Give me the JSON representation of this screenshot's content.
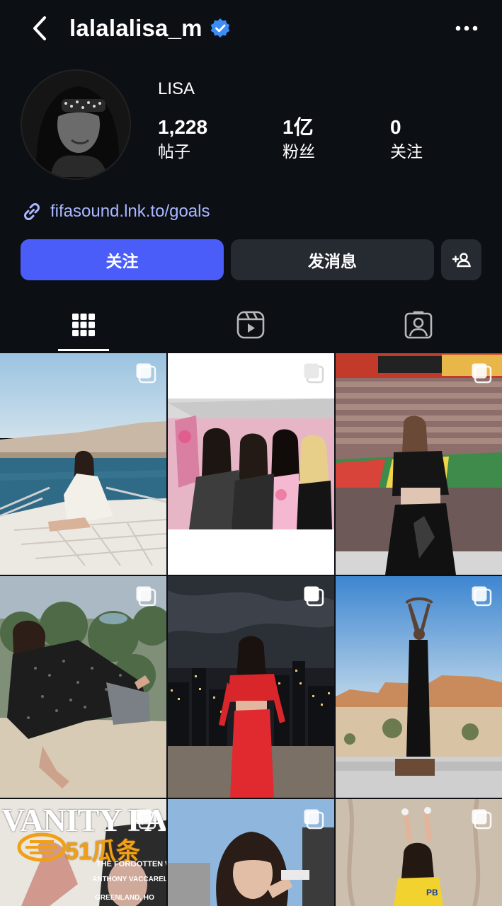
{
  "header": {
    "username": "lalalalisa_m",
    "back_icon": "chevron-left-icon",
    "verified_icon": "verified-badge-icon",
    "more_icon": "more-horizontal-icon"
  },
  "profile": {
    "display_name": "LISA",
    "stats": [
      {
        "value": "1,228",
        "label": "帖子"
      },
      {
        "value": "1亿",
        "label": "粉丝"
      },
      {
        "value": "0",
        "label": "关注"
      }
    ],
    "link": "fifasound.lnk.to/goals",
    "link_icon": "link-icon"
  },
  "actions": {
    "follow_label": "关注",
    "message_label": "发消息",
    "add_icon": "add-person-icon"
  },
  "tabs": [
    {
      "name": "grid-tab",
      "icon": "grid-icon",
      "selected": true
    },
    {
      "name": "reels-tab",
      "icon": "reels-icon",
      "selected": false
    },
    {
      "name": "tagged-tab",
      "icon": "tagged-person-icon",
      "selected": false
    }
  ],
  "posts": [
    {
      "name": "post-1",
      "multi": true
    },
    {
      "name": "post-2",
      "multi": true
    },
    {
      "name": "post-3",
      "multi": true
    },
    {
      "name": "post-4",
      "multi": true
    },
    {
      "name": "post-5",
      "multi": true
    },
    {
      "name": "post-6",
      "multi": true
    },
    {
      "name": "post-7",
      "multi": true,
      "overlay_text": [
        "VANITY FAIR",
        "51瓜条",
        "THE FORGOTTEN WA",
        "ANTHONY VACCARELLO",
        "GREENLAND, HO"
      ]
    },
    {
      "name": "post-8",
      "multi": true
    },
    {
      "name": "post-9",
      "multi": true
    }
  ],
  "colors": {
    "background": "#0c0f14",
    "follow_button": "#4a5df9",
    "secondary_button": "#262a31",
    "link": "#a9b8ff",
    "verified": "#3b8cf5"
  }
}
